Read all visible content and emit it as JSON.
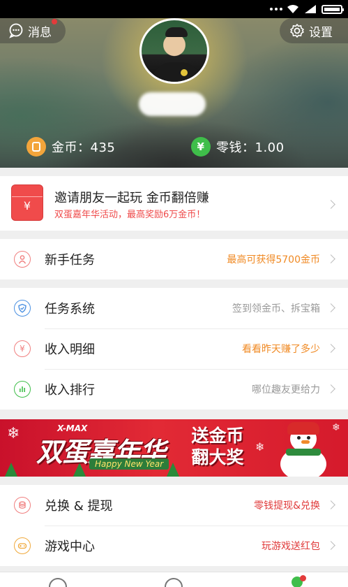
{
  "header": {
    "messages_label": "消息",
    "settings_label": "设置",
    "gold_label": "金币：435",
    "cash_label": "零钱：1.00",
    "cash_icon_glyph": "¥"
  },
  "invite": {
    "title": "邀请朋友一起玩 金币翻倍赚",
    "subtitle": "双蛋嘉年华活动，最高奖励6万金币！",
    "icon_glyph": "¥"
  },
  "section1": [
    {
      "label": "新手任务",
      "hint": "最高可获得5700金币",
      "hint_color": "#f08a24",
      "icon": "person-icon",
      "icon_color": "#f07f7f"
    }
  ],
  "section2": [
    {
      "label": "任务系统",
      "hint": "签到领金币、拆宝箱",
      "hint_color": "#999999",
      "icon": "shield-icon",
      "icon_color": "#4a90e2"
    },
    {
      "label": "收入明细",
      "hint": "看看昨天赚了多少",
      "hint_color": "#f08a24",
      "icon": "yen-icon",
      "icon_color": "#f07f7f",
      "icon_glyph": "¥"
    },
    {
      "label": "收入排行",
      "hint": "哪位趣友更给力",
      "hint_color": "#999999",
      "icon": "ranking-icon",
      "icon_color": "#3fbe4a"
    }
  ],
  "banner": {
    "xmax": "X-MAX",
    "title": "双蛋嘉年华",
    "happy": "Happy New Year",
    "promo_line1": "送金币",
    "promo_line2": "翻大奖"
  },
  "section3": [
    {
      "label": "兑换 & 提现",
      "hint": "零钱提现&兑换",
      "hint_color": "#e03a3a",
      "icon": "coins-icon",
      "icon_color": "#f07f7f"
    },
    {
      "label": "游戏中心",
      "hint": "玩游戏送红包",
      "hint_color": "#e03a3a",
      "icon": "gamepad-icon",
      "icon_color": "#f0a93b"
    }
  ]
}
